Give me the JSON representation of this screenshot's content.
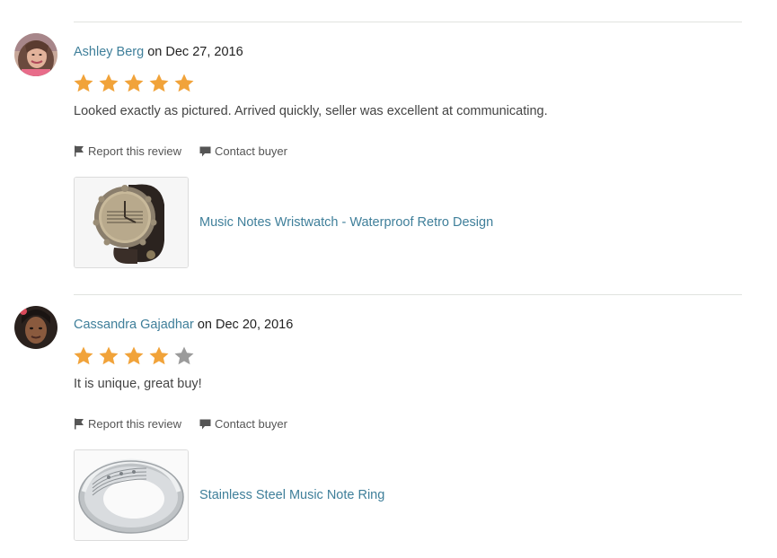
{
  "colors": {
    "link": "#3f7f9a",
    "star_filled": "#f1a33a",
    "star_empty": "#9b9b9b",
    "divider": "#e1e3df"
  },
  "reviews": [
    {
      "reviewer": "Ashley Berg",
      "on_word": "on",
      "date": "Dec 27, 2016",
      "rating": 5,
      "rating_max": 5,
      "text": "Looked exactly as pictured. Arrived quickly, seller was excellent at communicating.",
      "report_label": "Report this review",
      "contact_label": "Contact buyer",
      "report_icon": "flag-icon",
      "contact_icon": "message-icon",
      "product_title": "Music Notes Wristwatch - Waterproof Retro Design",
      "product_image": "wristwatch"
    },
    {
      "reviewer": "Cassandra Gajadhar",
      "on_word": "on",
      "date": "Dec 20, 2016",
      "rating": 4,
      "rating_max": 5,
      "text": "It is unique, great buy!",
      "report_label": "Report this review",
      "contact_label": "Contact buyer",
      "report_icon": "flag-icon",
      "contact_icon": "message-icon",
      "product_title": "Stainless Steel Music Note Ring",
      "product_image": "ring"
    }
  ]
}
